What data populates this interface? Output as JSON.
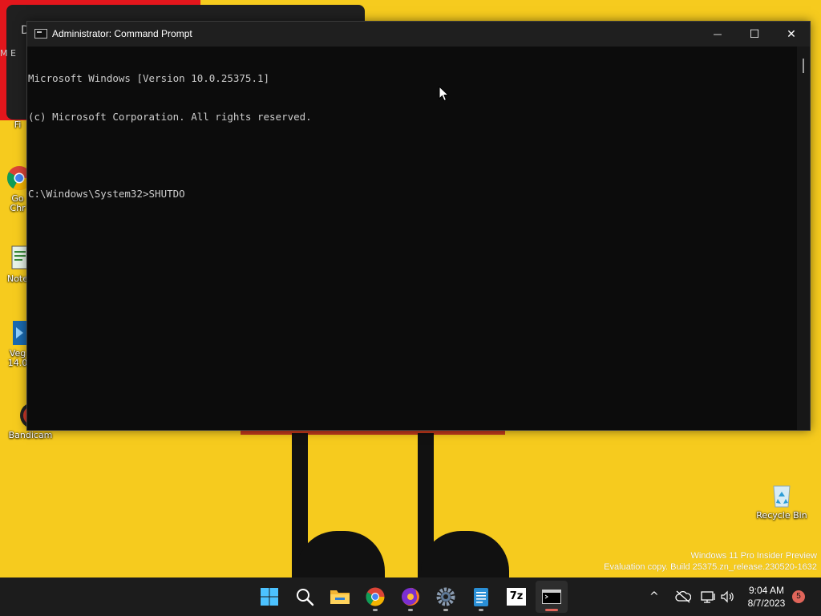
{
  "window": {
    "title": "Administrator: Command Prompt",
    "minimize_glyph": "—",
    "maximize_glyph": "☐",
    "close_glyph": "✕"
  },
  "console": {
    "lines": [
      "Microsoft Windows [Version 10.0.25375.1]",
      "(c) Microsoft Corporation. All rights reserved.",
      "",
      "C:\\Windows\\System32>SHUTDO"
    ]
  },
  "background_window": {
    "title": "D",
    "subtitle": "M E"
  },
  "desktop_icons": [
    {
      "label": "Fi",
      "icon": "file-explorer-icon"
    },
    {
      "label": "Go\nChr",
      "icon": "chrome-icon"
    },
    {
      "label": "Note",
      "icon": "notepad-icon"
    },
    {
      "label": "Veg\n14.0",
      "icon": "vegas-icon"
    },
    {
      "label": "Bandicam",
      "icon": "bandicam-icon"
    },
    {
      "label": "Recycle Bin",
      "icon": "recycle-bin-icon"
    }
  ],
  "watermark": {
    "line1": "Windows 11 Pro Insider Preview",
    "line2": "Evaluation copy. Build 25375.zn_release.230520-1632"
  },
  "taskbar": {
    "apps": [
      "start-icon",
      "search-icon",
      "file-explorer-icon",
      "chrome-icon",
      "firefox-icon",
      "settings-icon",
      "notepad-icon",
      "7zip-icon",
      "terminal-icon"
    ],
    "zip_label": "7z",
    "tray_chevron": "^",
    "time": "9:04 AM",
    "date": "8/7/2023",
    "notification_count": "5"
  },
  "colors": {
    "wallpaper": "#f6cb1e",
    "accent_red": "#e3161c",
    "console_bg": "#0c0c0c",
    "console_text": "#cccccc",
    "taskbar_bg": "#1c1c1c"
  }
}
